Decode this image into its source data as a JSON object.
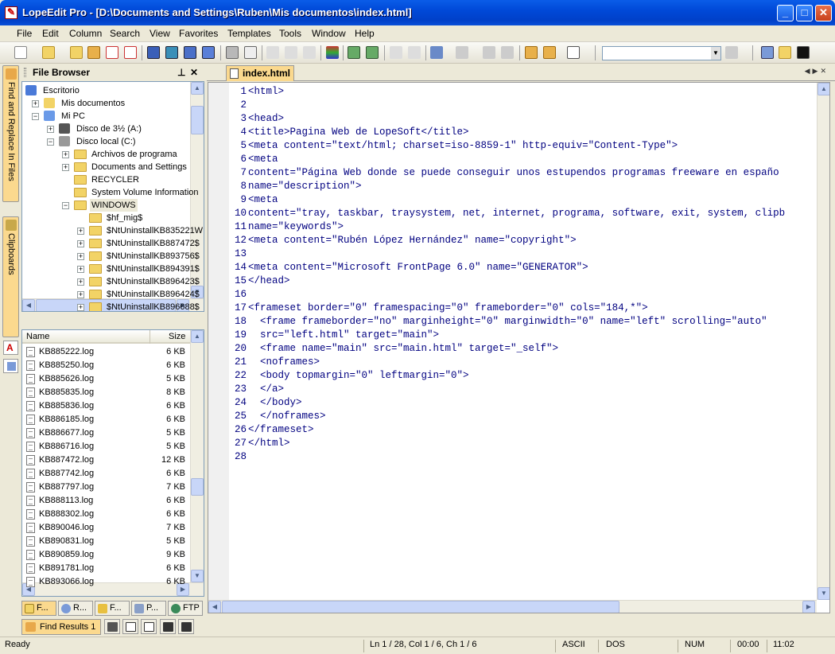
{
  "window": {
    "title": "LopeEdit Pro - [D:\\Documents and Settings\\Ruben\\Mis documentos\\index.html]",
    "minimize_icon": "minimize-icon",
    "maximize_icon": "maximize-icon",
    "close_icon": "close-icon"
  },
  "menu": [
    "File",
    "Edit",
    "Column",
    "Search",
    "View",
    "Favorites",
    "Templates",
    "Tools",
    "Window",
    "Help"
  ],
  "sidebar_tabs": [
    "Find and Replace In Files",
    "Clipboards"
  ],
  "file_browser": {
    "title": "File Browser",
    "pin_icon": "pin-icon",
    "close_icon": "close-icon",
    "tree": [
      {
        "label": "Escritorio",
        "icon": "desktop-icon",
        "level": 0,
        "toggle": ""
      },
      {
        "label": "Mis documentos",
        "icon": "my-documents-icon",
        "level": 1,
        "toggle": "+"
      },
      {
        "label": "Mi PC",
        "icon": "my-computer-icon",
        "level": 1,
        "toggle": "−"
      },
      {
        "label": "Disco de 3½ (A:)",
        "icon": "floppy-icon",
        "level": 2,
        "toggle": "+"
      },
      {
        "label": "Disco local (C:)",
        "icon": "drive-icon",
        "level": 2,
        "toggle": "−"
      },
      {
        "label": "Archivos de programa",
        "icon": "folder-icon",
        "level": 3,
        "toggle": "+"
      },
      {
        "label": "Documents and Settings",
        "icon": "folder-icon",
        "level": 3,
        "toggle": "+"
      },
      {
        "label": "RECYCLER",
        "icon": "folder-icon",
        "level": 3,
        "toggle": ""
      },
      {
        "label": "System Volume Information",
        "icon": "folder-icon",
        "level": 3,
        "toggle": ""
      },
      {
        "label": "WINDOWS",
        "icon": "folder-icon",
        "level": 3,
        "toggle": "−",
        "selected": true
      },
      {
        "label": "$hf_mig$",
        "icon": "folder-icon",
        "level": 4,
        "toggle": ""
      },
      {
        "label": "$NtUninstallKB835221W",
        "icon": "folder-icon",
        "level": 4,
        "toggle": "+"
      },
      {
        "label": "$NtUninstallKB887472$",
        "icon": "folder-icon",
        "level": 4,
        "toggle": "+"
      },
      {
        "label": "$NtUninstallKB893756$",
        "icon": "folder-icon",
        "level": 4,
        "toggle": "+"
      },
      {
        "label": "$NtUninstallKB894391$",
        "icon": "folder-icon",
        "level": 4,
        "toggle": "+"
      },
      {
        "label": "$NtUninstallKB896423$",
        "icon": "folder-icon",
        "level": 4,
        "toggle": "+"
      },
      {
        "label": "$NtUninstallKB896424$",
        "icon": "folder-icon",
        "level": 4,
        "toggle": "+"
      },
      {
        "label": "$NtUninstallKB896688$",
        "icon": "folder-icon",
        "level": 4,
        "toggle": "+"
      }
    ],
    "columns": {
      "name": "Name",
      "size": "Size"
    },
    "files": [
      {
        "name": "KB885222.log",
        "size": "6 KB"
      },
      {
        "name": "KB885250.log",
        "size": "6 KB"
      },
      {
        "name": "KB885626.log",
        "size": "5 KB"
      },
      {
        "name": "KB885835.log",
        "size": "8 KB"
      },
      {
        "name": "KB885836.log",
        "size": "6 KB"
      },
      {
        "name": "KB886185.log",
        "size": "6 KB"
      },
      {
        "name": "KB886677.log",
        "size": "5 KB"
      },
      {
        "name": "KB886716.log",
        "size": "5 KB"
      },
      {
        "name": "KB887472.log",
        "size": "12 KB"
      },
      {
        "name": "KB887742.log",
        "size": "6 KB"
      },
      {
        "name": "KB887797.log",
        "size": "7 KB"
      },
      {
        "name": "KB888113.log",
        "size": "6 KB"
      },
      {
        "name": "KB888302.log",
        "size": "6 KB"
      },
      {
        "name": "KB890046.log",
        "size": "7 KB"
      },
      {
        "name": "KB890831.log",
        "size": "5 KB"
      },
      {
        "name": "KB890859.log",
        "size": "9 KB"
      },
      {
        "name": "KB891781.log",
        "size": "6 KB"
      },
      {
        "name": "KB893066.log",
        "size": "6 KB"
      }
    ]
  },
  "panel_tabs": [
    "F...",
    "R...",
    "F...",
    "P...",
    "FTP"
  ],
  "results_tab": "Find Results 1",
  "editor": {
    "tab": "index.html",
    "lines": [
      {
        "n": "1",
        "t": "<html>"
      },
      {
        "n": "2",
        "t": ""
      },
      {
        "n": "3",
        "t": "<head>"
      },
      {
        "n": "4",
        "t": "<title>Pagina Web de LopeSoft</title>"
      },
      {
        "n": "5",
        "t": "<meta content=\"text/html; charset=iso-8859-1\" http-equiv=\"Content-Type\">"
      },
      {
        "n": "6",
        "t": "<meta"
      },
      {
        "n": "7",
        "t": "content=\"Página Web donde se puede conseguir unos estupendos programas freeware en españo"
      },
      {
        "n": "8",
        "t": "name=\"description\">"
      },
      {
        "n": "9",
        "t": "<meta"
      },
      {
        "n": "10",
        "t": "content=\"tray, taskbar, traysystem, net, internet, programa, software, exit, system, clipb"
      },
      {
        "n": "11",
        "t": "name=\"keywords\">"
      },
      {
        "n": "12",
        "t": "<meta content=\"Rubén López Hernández\" name=\"copyright\">"
      },
      {
        "n": "13",
        "t": ""
      },
      {
        "n": "14",
        "t": "<meta content=\"Microsoft FrontPage 6.0\" name=\"GENERATOR\">"
      },
      {
        "n": "15",
        "t": "</head>"
      },
      {
        "n": "16",
        "t": ""
      },
      {
        "n": "17",
        "t": "<frameset border=\"0\" framespacing=\"0\" frameborder=\"0\" cols=\"184,*\">"
      },
      {
        "n": "18",
        "t": "  <frame frameborder=\"no\" marginheight=\"0\" marginwidth=\"0\" name=\"left\" scrolling=\"auto\""
      },
      {
        "n": "19",
        "t": "  src=\"left.html\" target=\"main\">"
      },
      {
        "n": "20",
        "t": "  <frame name=\"main\" src=\"main.html\" target=\"_self\">"
      },
      {
        "n": "21",
        "t": "  <noframes>"
      },
      {
        "n": "22",
        "t": "  <body topmargin=\"0\" leftmargin=\"0\">"
      },
      {
        "n": "23",
        "t": "  </a>"
      },
      {
        "n": "24",
        "t": "  </body>"
      },
      {
        "n": "25",
        "t": "  </noframes>"
      },
      {
        "n": "26",
        "t": "</frameset>"
      },
      {
        "n": "27",
        "t": "</html>"
      },
      {
        "n": "28",
        "t": ""
      }
    ]
  },
  "status": {
    "ready": "Ready",
    "position": "Ln 1 / 28, Col 1 / 6, Ch 1 / 6",
    "encoding": "ASCII",
    "lineend": "DOS",
    "num": "NUM",
    "elapsed": "00:00",
    "time": "11:02"
  },
  "colors": {
    "tag": "#000080",
    "attr_value": "#800000",
    "accent_tab": "#fbd98e",
    "title_blue": "#0049d8"
  }
}
